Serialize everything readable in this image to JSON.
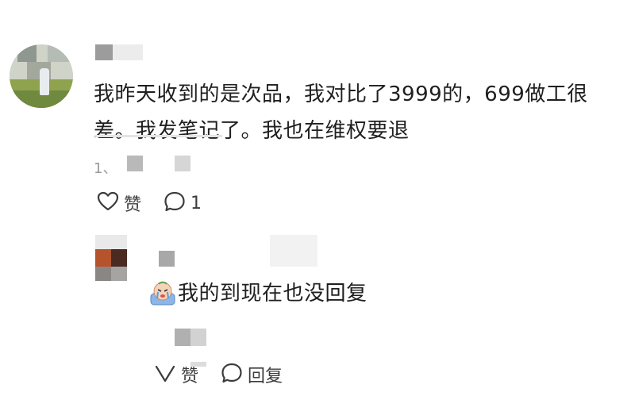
{
  "comment": {
    "text": "我昨天收到的是次品，我对比了3999的，699做工很差。我发笔记了。我也在维权要退",
    "meta": "1、",
    "like_label": "赞",
    "reply_count": "1"
  },
  "reply": {
    "emoji_name": "crying-face-emoji",
    "text": "我的到现在也没回复",
    "like_label": "赞",
    "reply_label": "回复"
  },
  "colors": {
    "text": "#1f1f1f",
    "meta": "#9a9a9a",
    "icon": "#3c3c3c"
  }
}
